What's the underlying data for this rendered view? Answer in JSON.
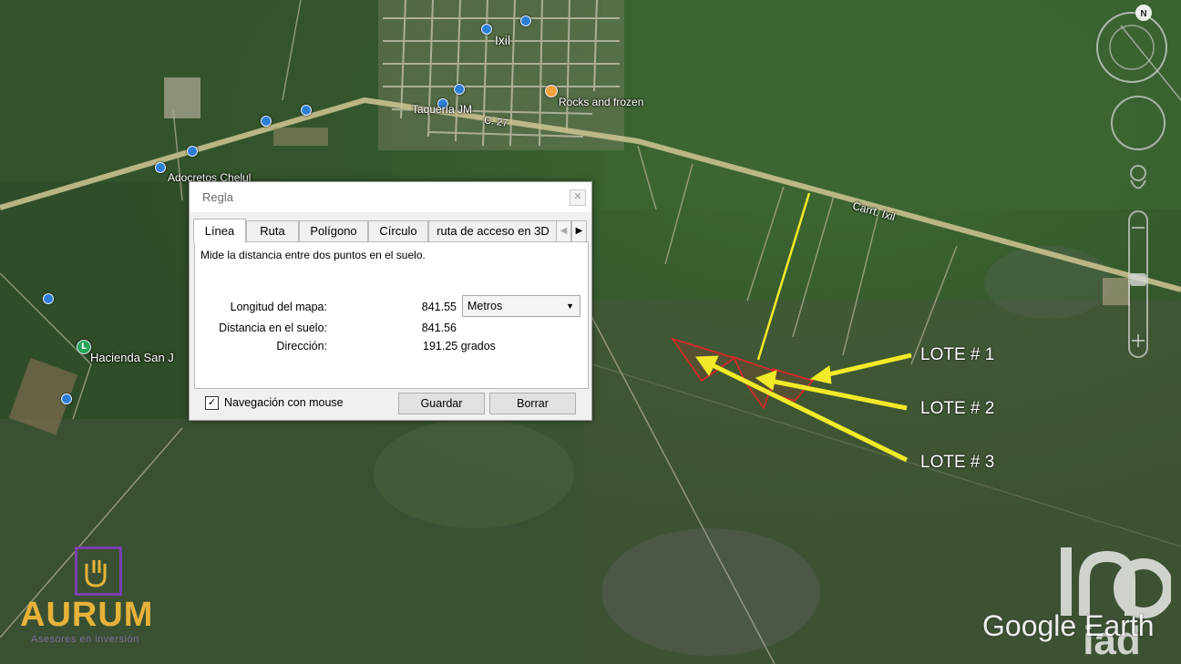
{
  "map": {
    "labels": {
      "town": "Ixil",
      "taqueria": "Taquería JM",
      "rocks": "Rocks and frozen",
      "adocretos": "Adocretos Chelul",
      "hacienda": "Hacienda San J",
      "santa_cruz": "Santa Cruz",
      "road_c27": "C. 27",
      "carretera": "Carrt. Ixil"
    }
  },
  "dialog": {
    "title": "Regla",
    "tabs": [
      "Línea",
      "Ruta",
      "Polígono",
      "Círculo",
      "ruta de acceso en 3D"
    ],
    "active_tab": "Línea",
    "description": "Mide la distancia entre dos puntos en el suelo.",
    "fields": {
      "map_length_label": "Longitud del mapa:",
      "map_length_value": "841.55",
      "ground_distance_label": "Distancia en el suelo:",
      "ground_distance_value": "841.56",
      "heading_label": "Dirección:",
      "heading_value": "191.25 grados"
    },
    "unit_selected": "Metros",
    "mouse_nav_label": "Navegación con mouse",
    "mouse_nav_checked": true,
    "save_label": "Guardar",
    "clear_label": "Borrar"
  },
  "lotes": [
    "LOTE # 1",
    "LOTE # 2",
    "LOTE # 3"
  ],
  "branding": {
    "aurum_name": "AURUM",
    "aurum_tagline": "Asesores en inversión",
    "google_earth": "Google Earth",
    "inmuebles": "in24"
  },
  "compass": {
    "north": "N"
  },
  "colors": {
    "arrow": "#f2ea28",
    "lot_outline": "#d42a2a",
    "road": "#c9c08e",
    "aurum_gold": "#e7b23a",
    "aurum_purple": "#7a3fb0"
  }
}
